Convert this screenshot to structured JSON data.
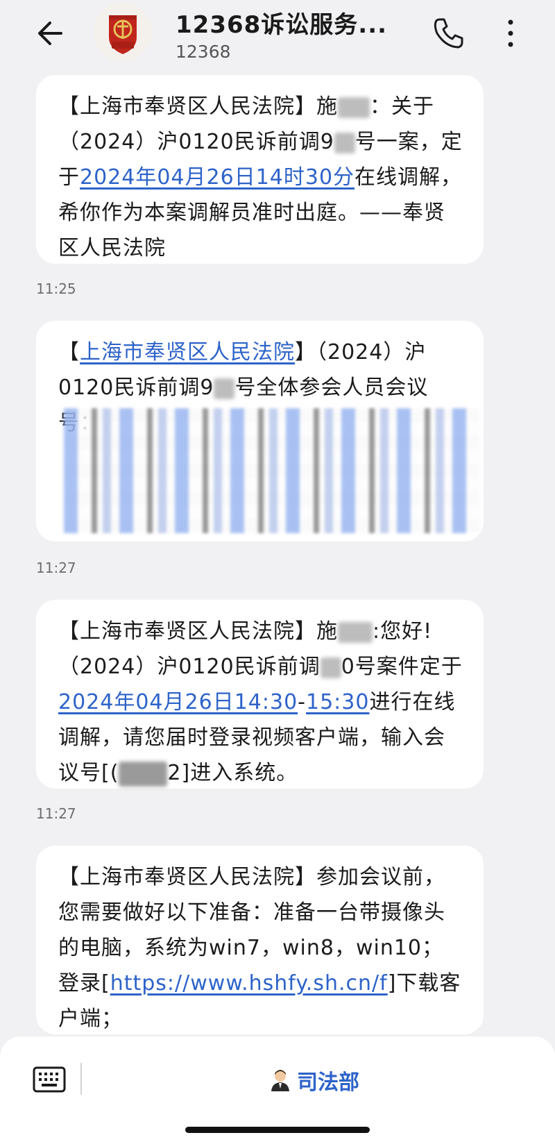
{
  "header": {
    "title": "12368诉讼服务...",
    "subtitle": "12368",
    "avatar_label": "党政机关",
    "back_icon": "back-arrow-icon",
    "phone_icon": "phone-icon",
    "more_icon": "more-vertical-icon"
  },
  "messages": [
    {
      "parts": {
        "p1": "【上海市奉贤区人民法院】施",
        "p2": "：关于（2024）沪0120民诉前调9",
        "p3": "号一案，定于",
        "date_link": "2024年04月26日14时30分",
        "p4": "在线调解，希你作为本案调解员准时出庭。——奉贤区人民法院"
      },
      "time": "11:25"
    },
    {
      "parts": {
        "p1": "【",
        "court_link": "上海市奉贤区人民法院",
        "p2": "】（2024）沪0120民诉前调9",
        "p3": "号全体参会人员会议号："
      },
      "time": "11:27"
    },
    {
      "parts": {
        "p1": "【上海市奉贤区人民法院】施",
        "p2": ":您好!（2024）沪0120民诉前调",
        "p3": "0号案件定于",
        "date_link": "2024年04月26日14:30",
        "dash": "-",
        "end_link": "15:30",
        "p4": "进行在线调解，请您届时登录视频客户端，输入会议号[(",
        "p5": "2]进入系统。"
      },
      "time": "11:27"
    },
    {
      "parts": {
        "p1": "【上海市奉贤区人民法院】参加会议前，您需要做好以下准备：准备一台带摄像头的电脑，系统为win7，win8，win10；登录[",
        "url_link": "https://www.hshfy.sh.cn/f",
        "p2": "]下载客户端；"
      }
    }
  ],
  "bottom": {
    "menu_label": "司法部",
    "keyboard_icon": "keyboard-icon",
    "menu_icon": "person-icon"
  },
  "colors": {
    "link": "#2d63c9",
    "background": "#f1f1f3",
    "bubble": "#ffffff",
    "avatar_badge": "#c0261c"
  }
}
